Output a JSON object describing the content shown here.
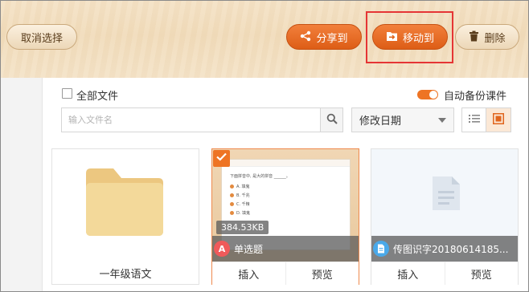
{
  "toolbar": {
    "cancel_label": "取消选择",
    "share_label": "分享到",
    "move_label": "移动到",
    "delete_label": "删除"
  },
  "filters": {
    "all_files_label": "全部文件",
    "auto_backup_label": "自动备份课件",
    "auto_backup_on": true
  },
  "search": {
    "placeholder": "输入文件名",
    "value": ""
  },
  "sort": {
    "selected": "修改日期"
  },
  "view": {
    "mode": "grid"
  },
  "files": [
    {
      "type": "folder",
      "name": "一年级语文"
    },
    {
      "type": "quiz",
      "name": "单选题",
      "size": "384.53KB",
      "selected": true,
      "type_letter": "A",
      "insert_label": "插入",
      "preview_label": "预览",
      "preview_doc": {
        "question": "下面拼音中, 是大的拼音 ______。",
        "options": [
          "A. 填鬼",
          "B. 千兆",
          "C. 千粮",
          "D. 填鬼"
        ]
      }
    },
    {
      "type": "document",
      "name": "传图识字20180614185...",
      "selected": false,
      "insert_label": "插入",
      "preview_label": "预览"
    }
  ],
  "colors": {
    "accent": "#ee7424",
    "highlight": "#e53535",
    "quiz_badge": "#f05a5a",
    "doc_badge": "#4aa9e9",
    "folder": "#f0cf8a"
  }
}
